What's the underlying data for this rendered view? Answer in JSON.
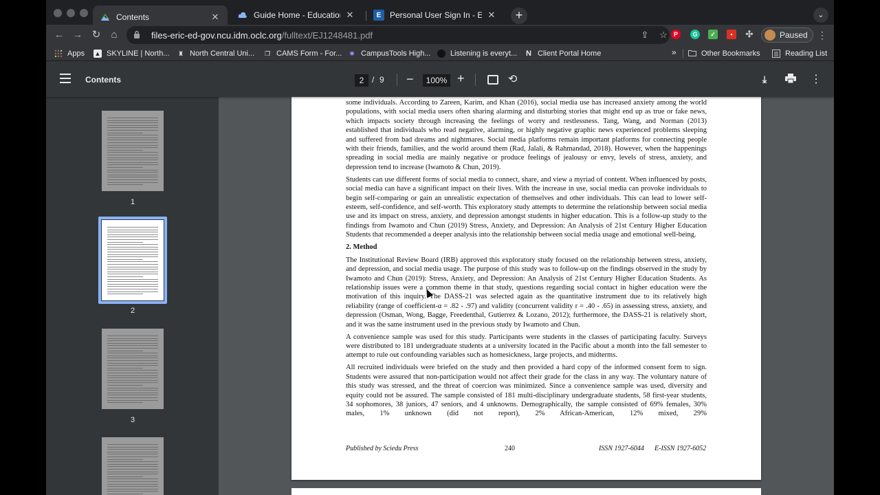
{
  "browser": {
    "tabs": [
      {
        "title": "Contents",
        "icon": "pdf-page-icon",
        "active": true
      },
      {
        "title": "Guide Home - Education - LibGuides",
        "icon": "cloud-icon",
        "active": false
      },
      {
        "title": "Personal User Sign In - EBSCO",
        "icon": "ebsco-e-icon",
        "active": false
      }
    ],
    "new_tab": "+",
    "tab_search": "⌄",
    "close_glyph": "✕",
    "url_host": "files-eric-ed-gov.ncu.idm.oclc.org",
    "url_path": "/fulltext/EJ1248481.pdf",
    "profile_label": "Paused",
    "bookmarks": [
      {
        "label": "Apps",
        "icon": "apps-grid-icon"
      },
      {
        "label": "SKYLINE | North...",
        "icon": "skyline-icon"
      },
      {
        "label": "North Central Uni...",
        "icon": "university-icon"
      },
      {
        "label": "CAMS Form - For...",
        "icon": "document-copy-icon"
      },
      {
        "label": "CampusTools High...",
        "icon": "campustools-icon"
      },
      {
        "label": "Listening is everyt...",
        "icon": "circle-icon"
      },
      {
        "label": "Client Portal Home",
        "icon": "n-logo-icon"
      },
      {
        "label": "Other Bookmarks",
        "icon": "folder-icon"
      },
      {
        "label": "Reading List",
        "icon": "reading-list-icon"
      }
    ],
    "bookmark_overflow": "»"
  },
  "pdf": {
    "title": "Contents",
    "current_page": "2",
    "page_separator": "/",
    "total_pages": "9",
    "zoom": "100%",
    "zoom_out": "−",
    "zoom_in": "+",
    "rotate": "⟲",
    "download": "⤓",
    "more": "⋮"
  },
  "thumbnails": [
    {
      "label": "1",
      "selected": false
    },
    {
      "label": "2",
      "selected": true
    },
    {
      "label": "3",
      "selected": false
    },
    {
      "label": "",
      "selected": false
    }
  ],
  "document": {
    "paragraphs": [
      "some individuals. According to Zareen, Karim, and Khan (2016), social media use has increased anxiety among the world populations, with social media users often sharing alarming and disturbing stories that might end up as true or fake news, which impacts society through increasing the feelings of worry and restlessness. Tang, Wang, and Norman (2013) established that individuals who read negative, alarming, or highly negative graphic news experienced problems sleeping and suffered from bad dreams and nightmares. Social media platforms remain important platforms for connecting people with their friends, families, and the world around them (Rad, Jalali, & Rahmandad, 2018). However, when the happenings spreading in social media are mainly negative or produce feelings of jealousy or envy, levels of stress, anxiety, and depression tend to increase (Iwamoto & Chun, 2019).",
      "Students can use different forms of social media to connect, share, and view a myriad of content. When influenced by posts, social media can have a significant impact on their lives. With the increase in use, social media can provoke individuals to begin self-comparing or gain an unrealistic expectation of themselves and other individuals. This can lead to lower self-esteem, self-confidence, and self-worth. This exploratory study attempts to determine the relationship between social media use and its impact on stress, anxiety, and depression amongst students in higher education. This is a follow-up study to the findings from Iwamoto and Chun (2019) Stress, Anxiety, and Depression: An Analysis of 21st Century Higher Education Students that recommended a deeper analysis into the relationship between social media usage and emotional well-being."
    ],
    "section_heading": "2. Method",
    "method_paragraphs": [
      "The Institutional Review Board (IRB) approved this exploratory study focused on the relationship between stress, anxiety, and depression, and social media usage. The purpose of this study was to follow-up on the findings observed in the study by Iwamoto and Chun (2019): Stress, Anxiety, and Depression: An Analysis of 21st Century Higher Education Students. As relationship issues were a common theme in that study, questions regarding social contact in higher education were the motivation of this inquiry. The DASS-21 was selected again as the quantitative instrument due to its relatively high reliability (range of coefficient-α = .82 - .97) and validity (concurrent validity r = .40 - .65) in assessing stress, anxiety, and depression (Osman, Wong, Bagge, Freedenthal, Gutierrez & Lozano, 2012); furthermore, the DASS-21 is relatively short, and it was the same instrument used in the previous study by Iwamoto and Chun.",
      "A convenience sample was used for this study. Participants were students in the classes of participating faculty. Surveys were distributed to 181 undergraduate students at a university located in the Pacific about a month into the fall semester to attempt to rule out confounding variables such as homesickness, large projects, and midterms.",
      "All recruited individuals were briefed on the study and then provided a hard copy of the informed consent form to sign. Students were assured that non-participation would not affect their grade for the class in any way. The voluntary nature of this study was stressed, and the threat of coercion was minimized. Since a convenience sample was used, diversity and equity could not be assured. The sample consisted of 181 multi-disciplinary undergraduate students, 58 first-year students, 34 sophomores, 38 juniors, 47 seniors, and 4 unknowns. Demographically, the sample consisted of 69% females, 30% males, 1% unknown (did not report), 2% African-American, 12% mixed, 29%"
    ],
    "footer": {
      "publisher": "Published by Sciedu Press",
      "page_number": "240",
      "issn": "ISSN 1927-6044",
      "eissn": "E-ISSN 1927-6052"
    }
  },
  "colors": {
    "accent": "#8ab4f8",
    "toolbar": "#323639",
    "viewer_bg": "#525659"
  }
}
